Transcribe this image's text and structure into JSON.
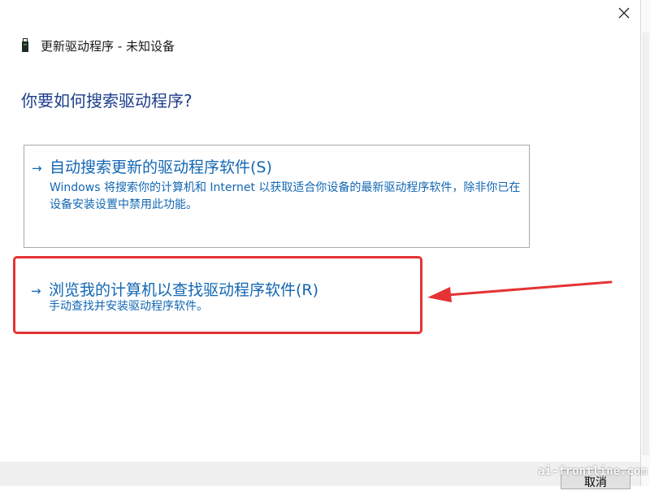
{
  "window": {
    "title": "更新驱动程序 - 未知设备",
    "close_icon": "close-icon",
    "device_icon": "usb-device-icon"
  },
  "heading": "你要如何搜索驱动程序?",
  "options": [
    {
      "arrow": "→",
      "title": "自动搜索更新的驱动程序软件(S)",
      "description": "Windows 将搜索你的计算机和 Internet 以获取适合你设备的最新驱动程序软件，除非你已在设备安装设置中禁用此功能。"
    },
    {
      "arrow": "→",
      "title": "浏览我的计算机以查找驱动程序软件(R)",
      "description": "手动查找并安装驱动程序软件。"
    }
  ],
  "footer": {
    "cancel_label": "取消"
  },
  "watermark": "ai-frontline.com",
  "colors": {
    "link_blue": "#1267b3",
    "heading_blue": "#1c3d8c",
    "annotation_red": "#e53333"
  }
}
